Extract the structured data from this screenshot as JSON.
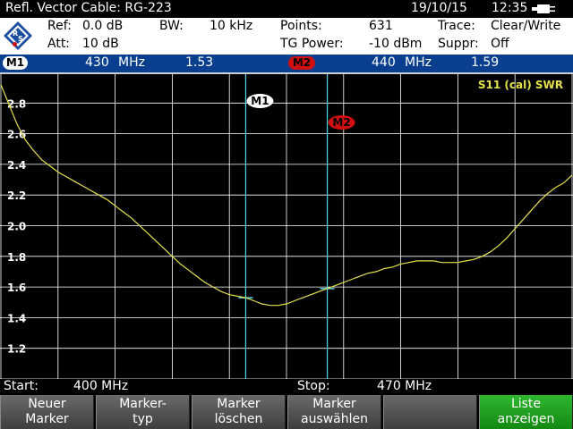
{
  "header": {
    "title": "Refl. Vector  Cable: RG-223",
    "date": "19/10/15",
    "time": "12:35"
  },
  "info": {
    "ref_label": "Ref:",
    "ref_value": "0.0 dB",
    "att_label": "Att:",
    "att_value": "10 dB",
    "bw_label": "BW:",
    "bw_value": "10 kHz",
    "points_label": "Points:",
    "points_value": "631",
    "tg_label": "TG Power:",
    "tg_value": "-10 dBm",
    "trace_label": "Trace:",
    "trace_value": "Clear/Write",
    "suppr_label": "Suppr:",
    "suppr_value": "Off"
  },
  "markers": [
    {
      "label": "M1",
      "freq": "430",
      "unit": "MHz",
      "value": "1.53"
    },
    {
      "label": "M2",
      "freq": "440",
      "unit": "MHz",
      "value": "1.59"
    }
  ],
  "plot": {
    "trace_label": "S11 (cal) SWR",
    "y_ticks": [
      "2.8",
      "2.6",
      "2.4",
      "2.2",
      "2.0",
      "1.8",
      "1.6",
      "1.4",
      "1.2"
    ],
    "colors": {
      "trace": "#e6e24a",
      "grid": "#ffffff",
      "marker_line": "#4fd6e8"
    }
  },
  "chart_data": {
    "type": "line",
    "title": "",
    "xlabel": "",
    "ylabel": "",
    "x_range": [
      400,
      470
    ],
    "ylim": [
      1.0,
      3.0
    ],
    "grid": true,
    "series": [
      {
        "name": "S11 (cal) SWR",
        "x": [
          400,
          401,
          402,
          403,
          404,
          405,
          406,
          407,
          408,
          409,
          410,
          411,
          412,
          413,
          414,
          415,
          416,
          417,
          418,
          419,
          420,
          421,
          422,
          423,
          424,
          425,
          426,
          427,
          428,
          429,
          430,
          431,
          432,
          433,
          434,
          435,
          436,
          437,
          438,
          439,
          440,
          441,
          442,
          443,
          444,
          445,
          446,
          447,
          448,
          449,
          450,
          451,
          452,
          453,
          454,
          455,
          456,
          457,
          458,
          459,
          460,
          461,
          462,
          463,
          464,
          465,
          466,
          467,
          468,
          469,
          470
        ],
        "values": [
          2.92,
          2.79,
          2.66,
          2.56,
          2.49,
          2.43,
          2.39,
          2.35,
          2.32,
          2.29,
          2.26,
          2.23,
          2.2,
          2.17,
          2.13,
          2.09,
          2.05,
          2.0,
          1.95,
          1.9,
          1.85,
          1.8,
          1.75,
          1.71,
          1.67,
          1.63,
          1.6,
          1.57,
          1.55,
          1.54,
          1.53,
          1.51,
          1.49,
          1.48,
          1.48,
          1.49,
          1.51,
          1.53,
          1.55,
          1.57,
          1.59,
          1.61,
          1.63,
          1.65,
          1.67,
          1.69,
          1.7,
          1.72,
          1.73,
          1.75,
          1.76,
          1.77,
          1.77,
          1.77,
          1.76,
          1.76,
          1.76,
          1.77,
          1.78,
          1.8,
          1.83,
          1.87,
          1.92,
          1.98,
          2.04,
          2.1,
          2.16,
          2.21,
          2.25,
          2.28,
          2.33
        ]
      }
    ],
    "markers": [
      {
        "label": "M1",
        "x": 430,
        "y": 1.53
      },
      {
        "label": "M2",
        "x": 440,
        "y": 1.59
      }
    ]
  },
  "range": {
    "start_label": "Start:",
    "start_value": "400 MHz",
    "stop_label": "Stop:",
    "stop_value": "470 MHz"
  },
  "softkeys": [
    {
      "line1": "Neuer",
      "line2": "Marker"
    },
    {
      "line1": "Marker-",
      "line2": "typ"
    },
    {
      "line1": "Marker",
      "line2": "löschen"
    },
    {
      "line1": "Marker",
      "line2": "auswählen"
    },
    {
      "line1": "",
      "line2": ""
    },
    {
      "line1": "Liste",
      "line2": "anzeigen"
    }
  ]
}
